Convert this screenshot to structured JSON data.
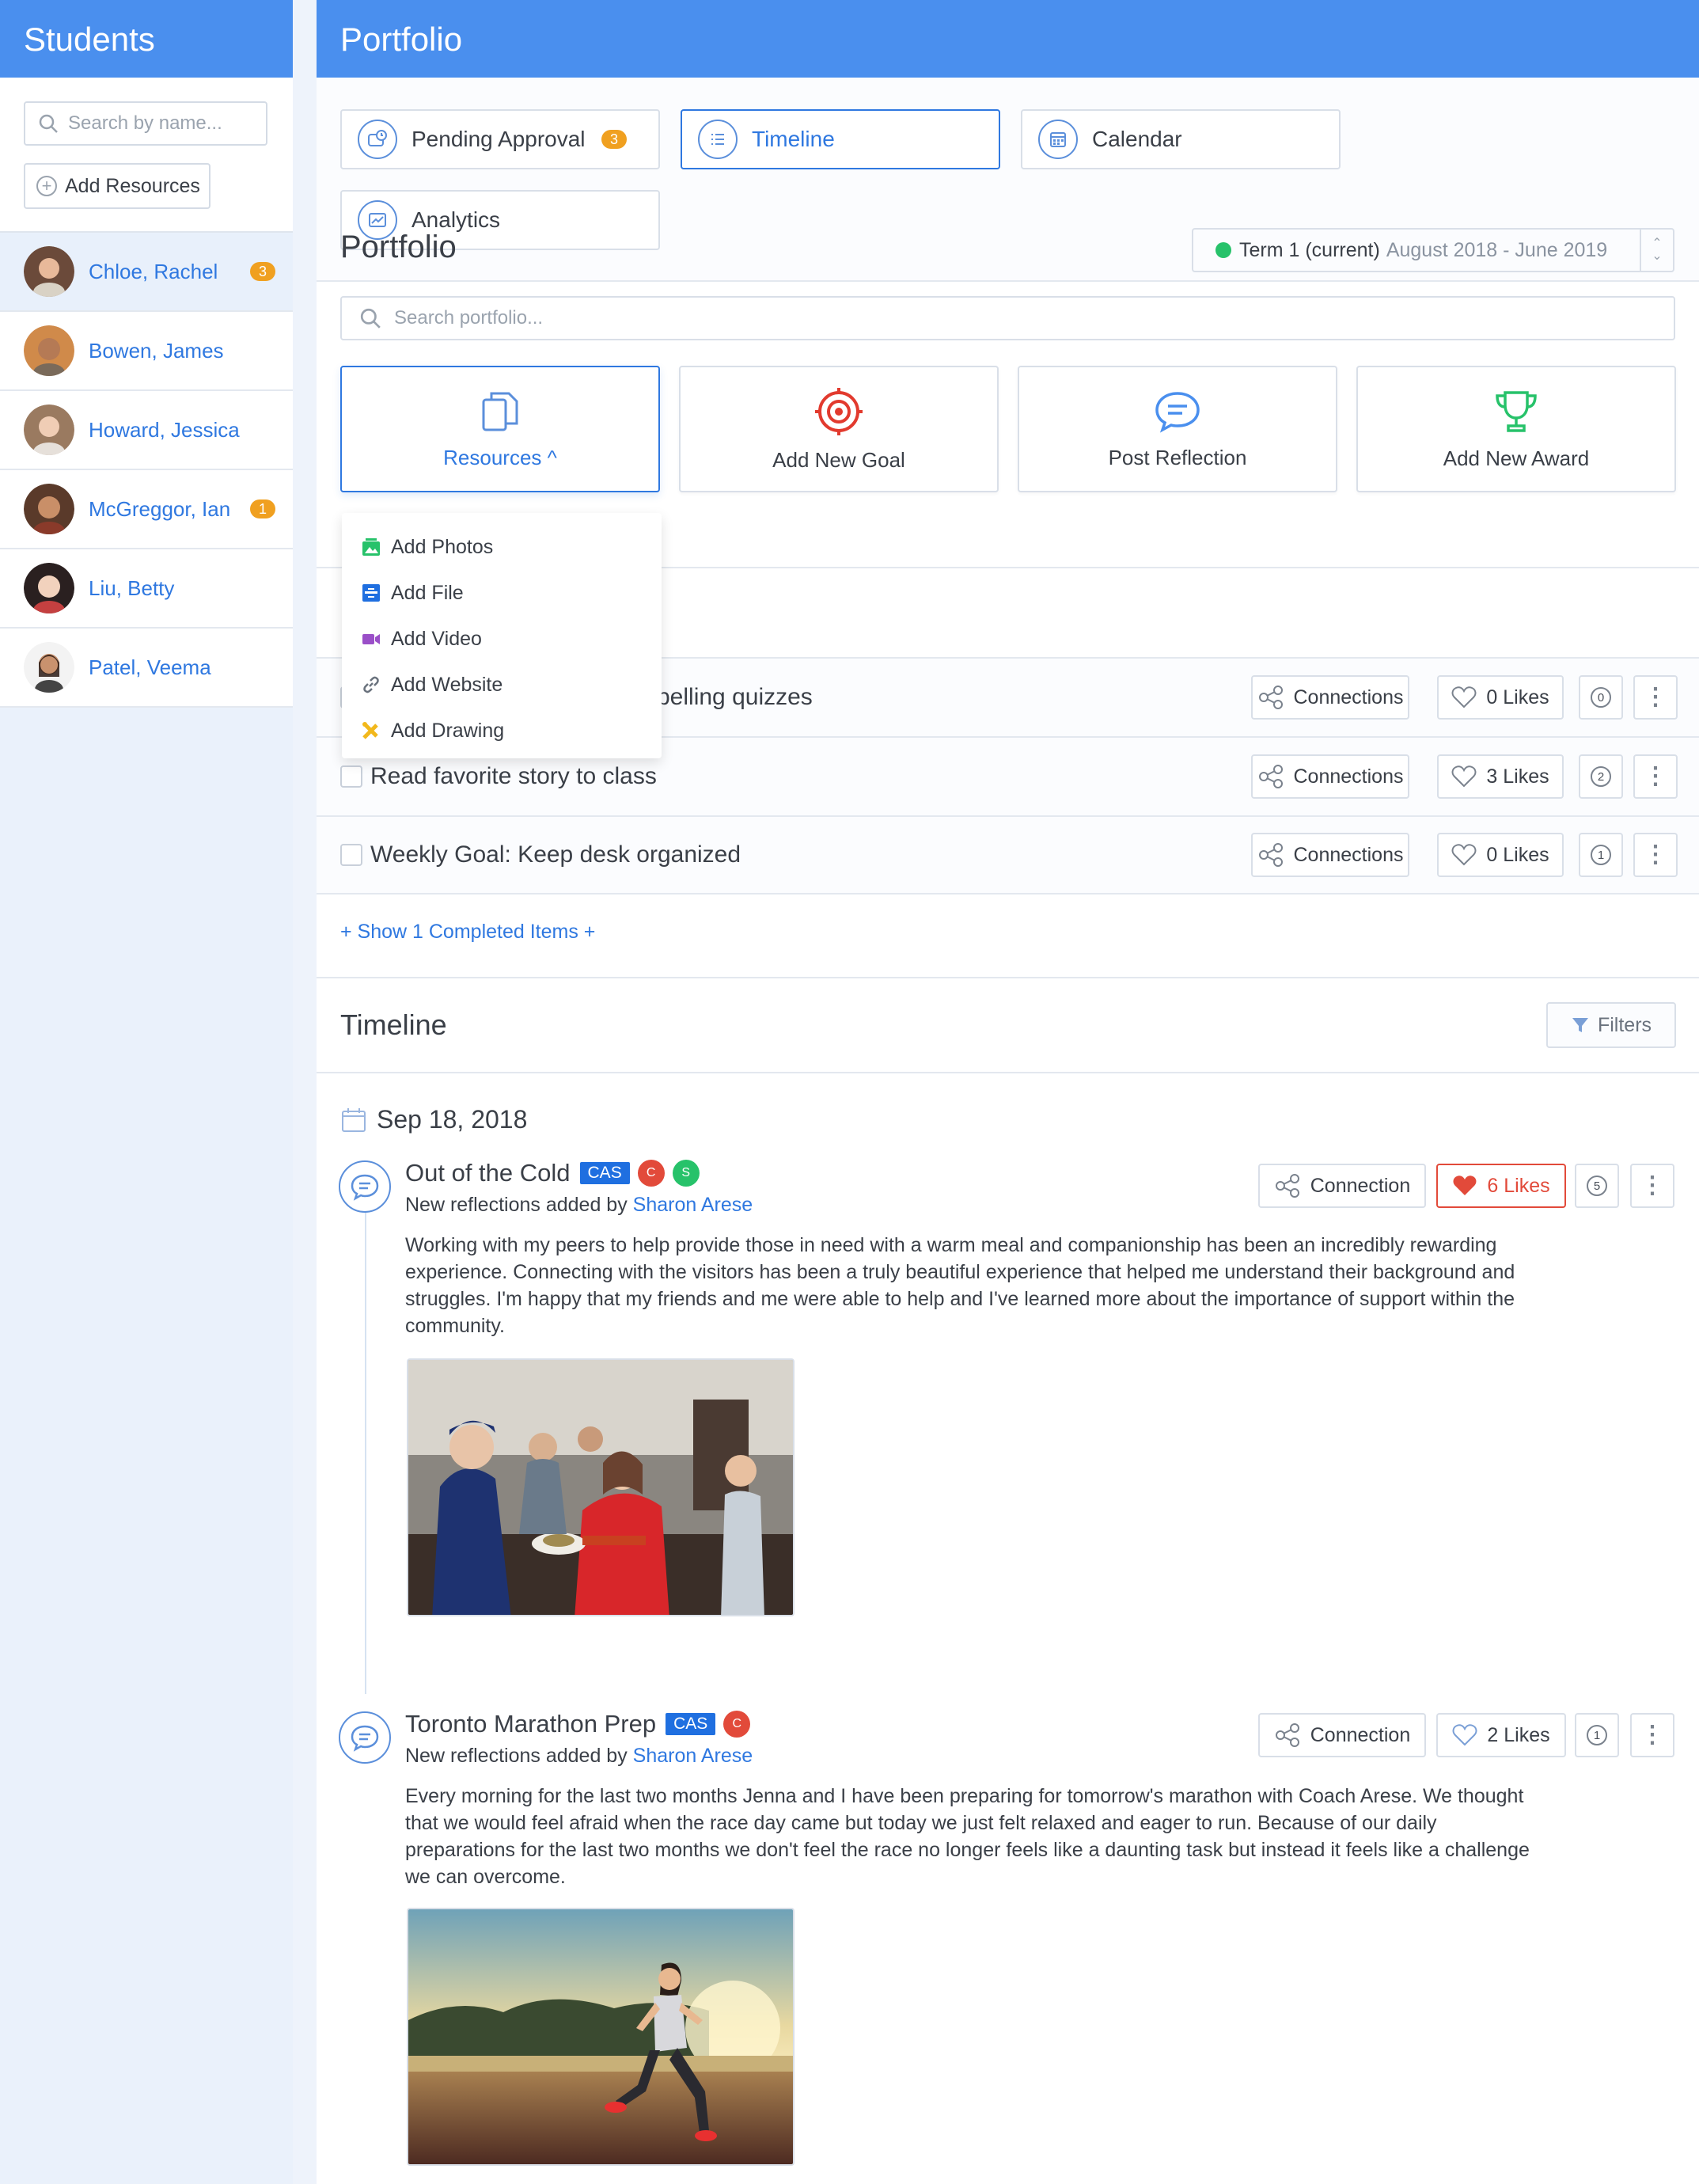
{
  "sidebar": {
    "title": "Students",
    "search_placeholder": "Search by name...",
    "add_resources": "Add Resources",
    "students": [
      {
        "name": "Chloe, Rachel",
        "badge": "3"
      },
      {
        "name": "Bowen, James",
        "badge": ""
      },
      {
        "name": "Howard, Jessica",
        "badge": ""
      },
      {
        "name": "McGreggor, Ian",
        "badge": "1"
      },
      {
        "name": "Liu, Betty",
        "badge": ""
      },
      {
        "name": "Patel, Veema",
        "badge": ""
      }
    ]
  },
  "header": {
    "title": "Portfolio"
  },
  "tabs": [
    {
      "label": "Pending Approval",
      "badge": "3"
    },
    {
      "label": "Timeline"
    },
    {
      "label": "Calendar"
    },
    {
      "label": "Analytics"
    }
  ],
  "portfolio": {
    "title": "Portfolio",
    "term_label": "Term 1 (current)",
    "term_range": "August 2018 - June 2019",
    "search_placeholder": "Search portfolio...",
    "cards": {
      "resources": "Resources ^",
      "goal": "Add New Goal",
      "reflection": "Post Reflection",
      "award": "Add New Award"
    },
    "dropdown": [
      "Add Photos",
      "Add File",
      "Add Video",
      "Add Website",
      "Add Drawing"
    ]
  },
  "goals": [
    {
      "text": "pelling quizzes",
      "connections": "Connections",
      "likes": "0 Likes",
      "comments": "0"
    },
    {
      "text": "Read favorite story to class",
      "connections": "Connections",
      "likes": "3 Likes",
      "comments": "2"
    },
    {
      "text": "Weekly Goal: Keep desk organized",
      "connections": "Connections",
      "likes": "0 Likes",
      "comments": "1"
    }
  ],
  "show_completed": "+ Show 1 Completed Items +",
  "timeline": {
    "title": "Timeline",
    "filters": "Filters",
    "date": "Sep 18, 2018",
    "entries": [
      {
        "title": "Out of the Cold",
        "tag": "CAS",
        "circles": [
          "C",
          "S"
        ],
        "sub_prefix": "New reflections added by",
        "author": "Sharon Arese",
        "body": "Working with my peers to help provide those in need with a warm meal and companionship has been an incredibly rewarding experience. Connecting with the visitors has been a truly beautiful experience that helped me understand their background and struggles. I'm happy that my friends and me were able to help and I've learned more about the importance of support within the community.",
        "connection": "Connection",
        "likes": "6 Likes",
        "comments": "5"
      },
      {
        "title": "Toronto Marathon Prep",
        "tag": "CAS",
        "circles": [
          "C"
        ],
        "sub_prefix": "New reflections added by",
        "author": "Sharon Arese",
        "body": "Every morning for the last two months Jenna and I have been preparing for tomorrow's marathon with Coach Arese. We thought that we would feel afraid when the race day came but today we just felt relaxed and eager to run. Because of our daily preparations for the last two months we don't feel the race no longer feels like a daunting task but instead it feels like a challenge we can overcome.",
        "connection": "Connection",
        "likes": "2 Likes",
        "comments": "1"
      }
    ]
  },
  "colors": {
    "brand": "#4a8fee",
    "link": "#2f78e0",
    "badge": "#f0a020",
    "like": "#e24a3a",
    "green": "#27c26a"
  }
}
